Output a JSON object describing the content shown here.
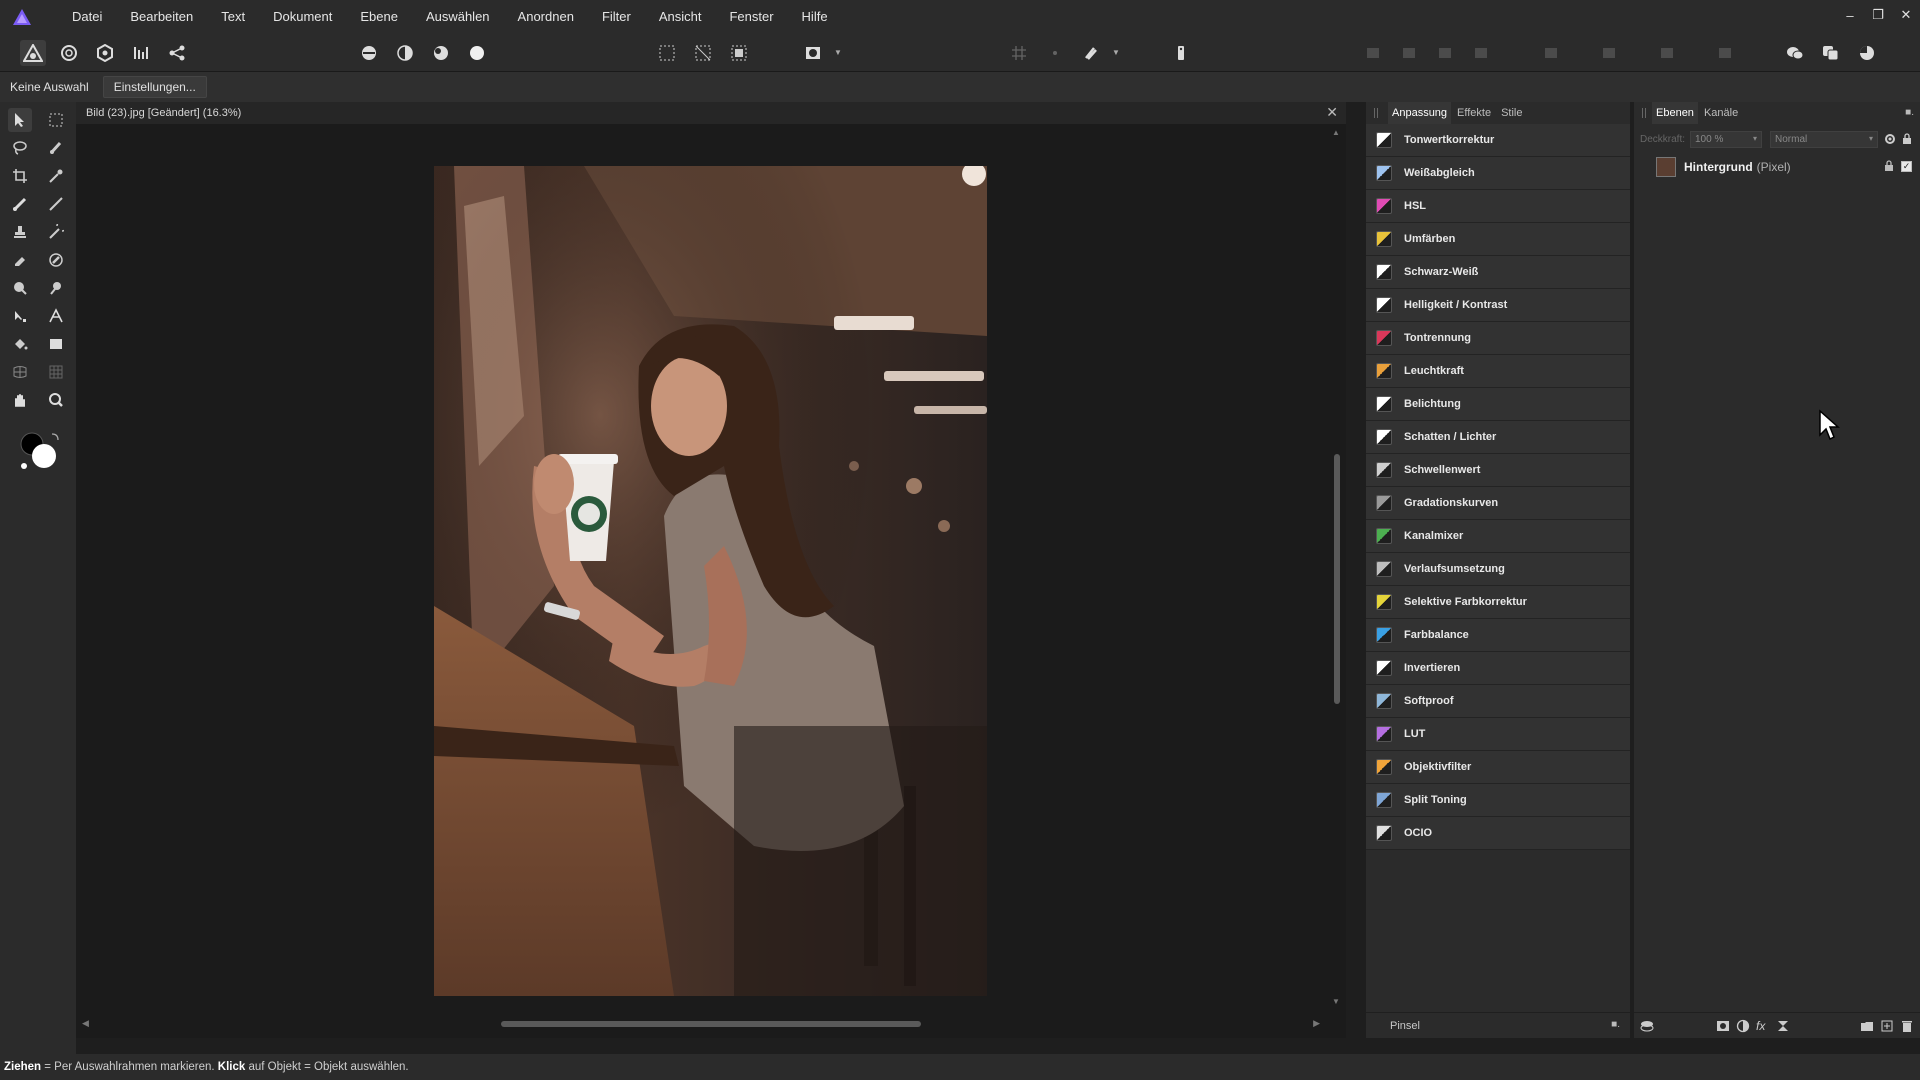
{
  "menu": {
    "items": [
      "Datei",
      "Bearbeiten",
      "Text",
      "Dokument",
      "Ebene",
      "Auswählen",
      "Anordnen",
      "Filter",
      "Ansicht",
      "Fenster",
      "Hilfe"
    ]
  },
  "window_controls": {
    "minimize": "–",
    "restore": "❐",
    "close": "✕"
  },
  "context": {
    "selection_label": "Keine Auswahl",
    "settings_button": "Einstellungen..."
  },
  "document": {
    "title": "Bild (23).jpg [Geändert] (16.3%)",
    "close": "✕"
  },
  "adjustments_panel": {
    "tabs": [
      "Anpassung",
      "Effekte",
      "Stile"
    ],
    "active_tab": "Anpassung",
    "items": [
      {
        "label": "Tonwertkorrektur",
        "icon": "levels-icon",
        "color": "#ffffff"
      },
      {
        "label": "Weißabgleich",
        "icon": "white-balance-icon",
        "color": "#9ec3ef"
      },
      {
        "label": "HSL",
        "icon": "hsl-icon",
        "color": "#e04bb4"
      },
      {
        "label": "Umfärben",
        "icon": "recolor-icon",
        "color": "#e8c23a"
      },
      {
        "label": "Schwarz-Weiß",
        "icon": "black-white-icon",
        "color": "#ffffff"
      },
      {
        "label": "Helligkeit / Kontrast",
        "icon": "brightness-contrast-icon",
        "color": "#ffffff"
      },
      {
        "label": "Tontrennung",
        "icon": "posterize-icon",
        "color": "#d9385a"
      },
      {
        "label": "Leuchtkraft",
        "icon": "vibrance-icon",
        "color": "#e9a03b"
      },
      {
        "label": "Belichtung",
        "icon": "exposure-icon",
        "color": "#ffffff"
      },
      {
        "label": "Schatten / Lichter",
        "icon": "shadows-highlights-icon",
        "color": "#ffffff"
      },
      {
        "label": "Schwellenwert",
        "icon": "threshold-icon",
        "color": "#cfcfcf"
      },
      {
        "label": "Gradationskurven",
        "icon": "curves-icon",
        "color": "#9a9a9a"
      },
      {
        "label": "Kanalmixer",
        "icon": "channel-mixer-icon",
        "color": "#4caf50"
      },
      {
        "label": "Verlaufsumsetzung",
        "icon": "gradient-map-icon",
        "color": "#bdbdbd"
      },
      {
        "label": "Selektive Farbkorrektur",
        "icon": "selective-color-icon",
        "color": "#e4d43a"
      },
      {
        "label": "Farbbalance",
        "icon": "color-balance-icon",
        "color": "#3aa0e4"
      },
      {
        "label": "Invertieren",
        "icon": "invert-icon",
        "color": "#ffffff"
      },
      {
        "label": "Softproof",
        "icon": "soft-proof-icon",
        "color": "#8fb7d9"
      },
      {
        "label": "LUT",
        "icon": "lut-icon",
        "color": "#b46ee0"
      },
      {
        "label": "Objektivfilter",
        "icon": "lens-filter-icon",
        "color": "#f0a43a"
      },
      {
        "label": "Split Toning",
        "icon": "split-toning-icon",
        "color": "#7fa6d6"
      },
      {
        "label": "OCIO",
        "icon": "ocio-icon",
        "color": "#e0e0e0"
      }
    ],
    "bottom_label": "Pinsel"
  },
  "layers_panel": {
    "tabs": [
      "Ebenen",
      "Kanäle"
    ],
    "active_tab": "Ebenen",
    "opacity_label": "Deckkraft:",
    "opacity_value": "100 %",
    "blend_mode": "Normal",
    "layer": {
      "name": "Hintergrund",
      "type": "(Pixel)"
    }
  },
  "status": {
    "drag_key": "Ziehen",
    "drag_text": " = Per Auswahlrahmen markieren. ",
    "click_key": "Klick",
    "click_text": " auf Objekt = Objekt auswählen."
  },
  "colors": {
    "accent": "#7b5cf5",
    "panel_bg": "#2b2b2b",
    "canvas_bg": "#1b1b1b"
  }
}
